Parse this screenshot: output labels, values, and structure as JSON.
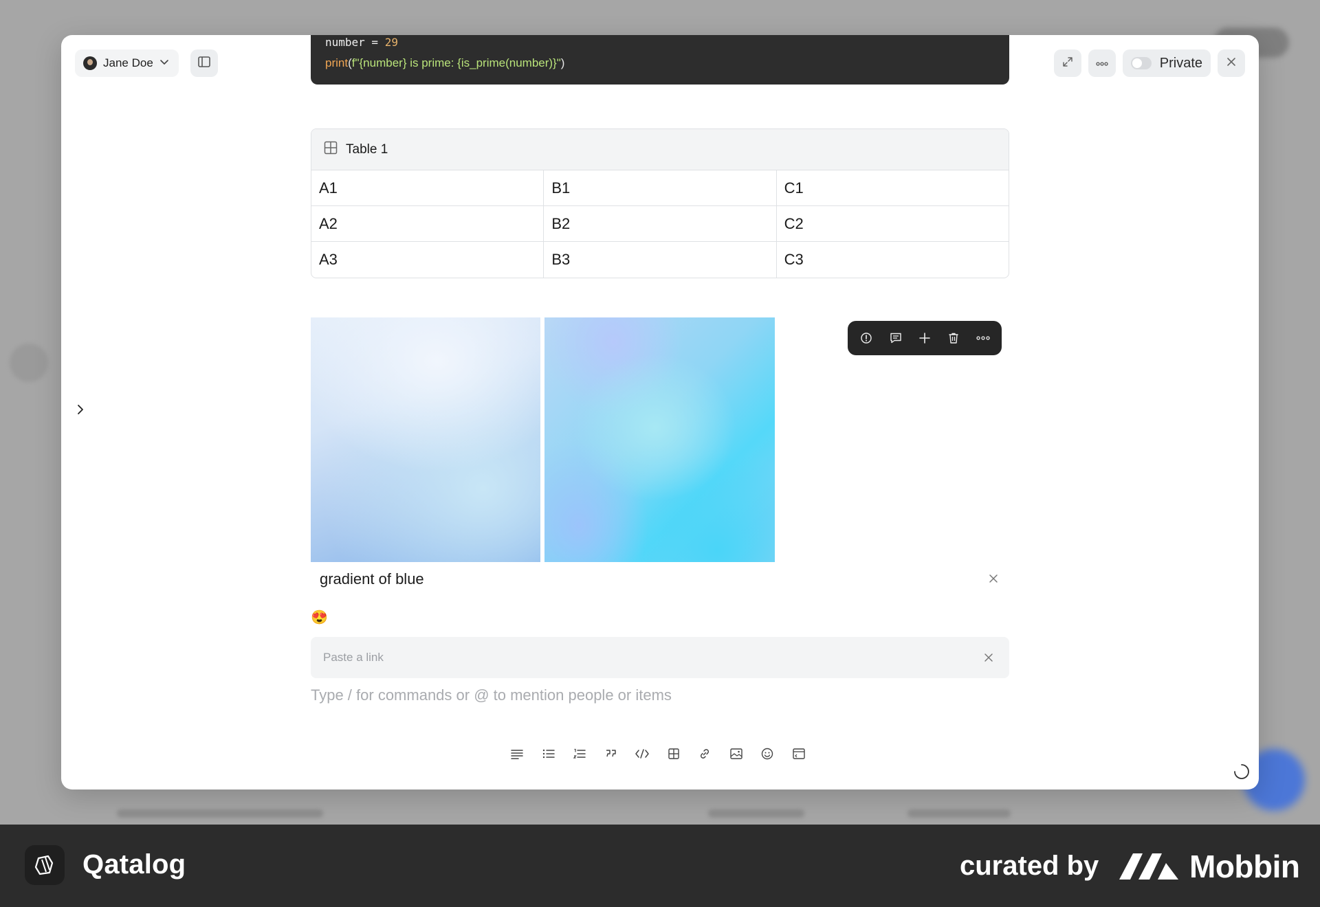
{
  "user": {
    "name": "Jane Doe"
  },
  "header": {
    "privacy_label": "Private"
  },
  "code": {
    "line1_var": "number",
    "line1_op": " = ",
    "line1_value": "29",
    "line2_fn": "print",
    "line2_open": "(",
    "line2_string": "f\"{number} is prime: {is_prime(number)}\"",
    "line2_close": ")"
  },
  "table": {
    "title": "Table 1",
    "rows": [
      [
        "A1",
        "B1",
        "C1"
      ],
      [
        "A2",
        "B2",
        "C2"
      ],
      [
        "A3",
        "B3",
        "C3"
      ]
    ]
  },
  "gallery": {
    "caption": "gradient of blue",
    "images": [
      "blue-gradient-light",
      "cyan-gradient"
    ]
  },
  "emoji": "😍",
  "link_input": {
    "placeholder": "Paste a link",
    "value": ""
  },
  "editor": {
    "placeholder": "Type / for commands or @ to mention people or items"
  },
  "image_toolbar": [
    "alert-icon",
    "comment-icon",
    "plus-icon",
    "trash-icon",
    "more-icon"
  ],
  "format_toolbar": [
    "paragraph-icon",
    "bullet-list-icon",
    "numbered-list-icon",
    "quote-icon",
    "code-icon",
    "table-icon",
    "link-icon",
    "image-icon",
    "emoji-icon",
    "embed-icon"
  ],
  "footer": {
    "brand": "Qatalog",
    "curated_by": "curated by",
    "curator": "Mobbin"
  },
  "colors": {
    "modal_bg": "#ffffff",
    "code_bg": "#2d2d2d",
    "code_fn": "#f0a654",
    "code_string": "#b9e37a",
    "code_number": "#e8b36b",
    "footer_bg": "#2c2c2c",
    "accent_fab": "#3d6fe0"
  }
}
